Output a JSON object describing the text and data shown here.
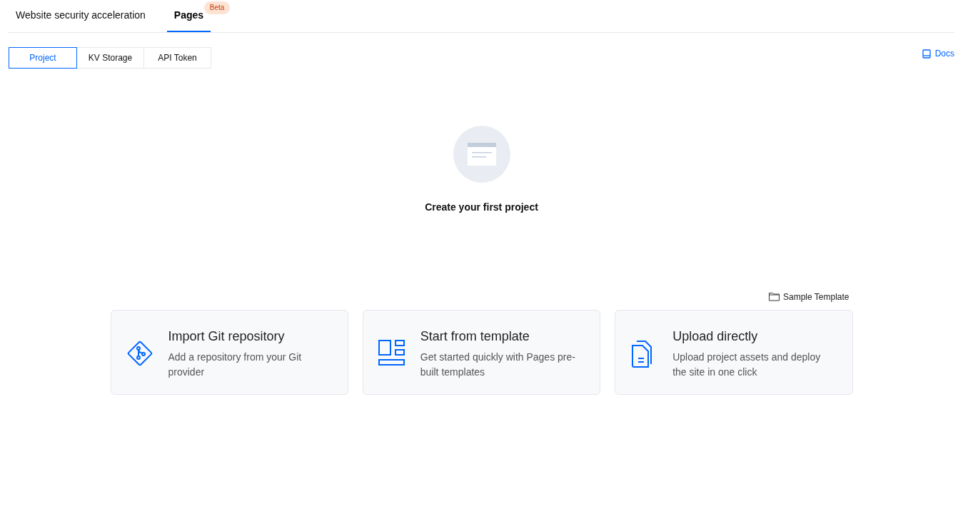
{
  "top_tabs": [
    {
      "label": "Website security acceleration",
      "selected": false
    },
    {
      "label": "Pages",
      "selected": true,
      "badge": "Beta"
    }
  ],
  "sub_tabs": [
    {
      "label": "Project",
      "selected": true
    },
    {
      "label": "KV Storage",
      "selected": false
    },
    {
      "label": "API Token",
      "selected": false
    }
  ],
  "docs_link": "Docs",
  "empty_state": {
    "title": "Create your first project"
  },
  "sample_template_link": "Sample Template",
  "cards": [
    {
      "kind": "git",
      "title": "Import Git repository",
      "description": "Add a repository from your Git provider"
    },
    {
      "kind": "template",
      "title": "Start from template",
      "description": "Get started quickly with Pages pre-built templates"
    },
    {
      "kind": "upload",
      "title": "Upload directly",
      "description": "Upload project assets and deploy the site in one click"
    }
  ]
}
